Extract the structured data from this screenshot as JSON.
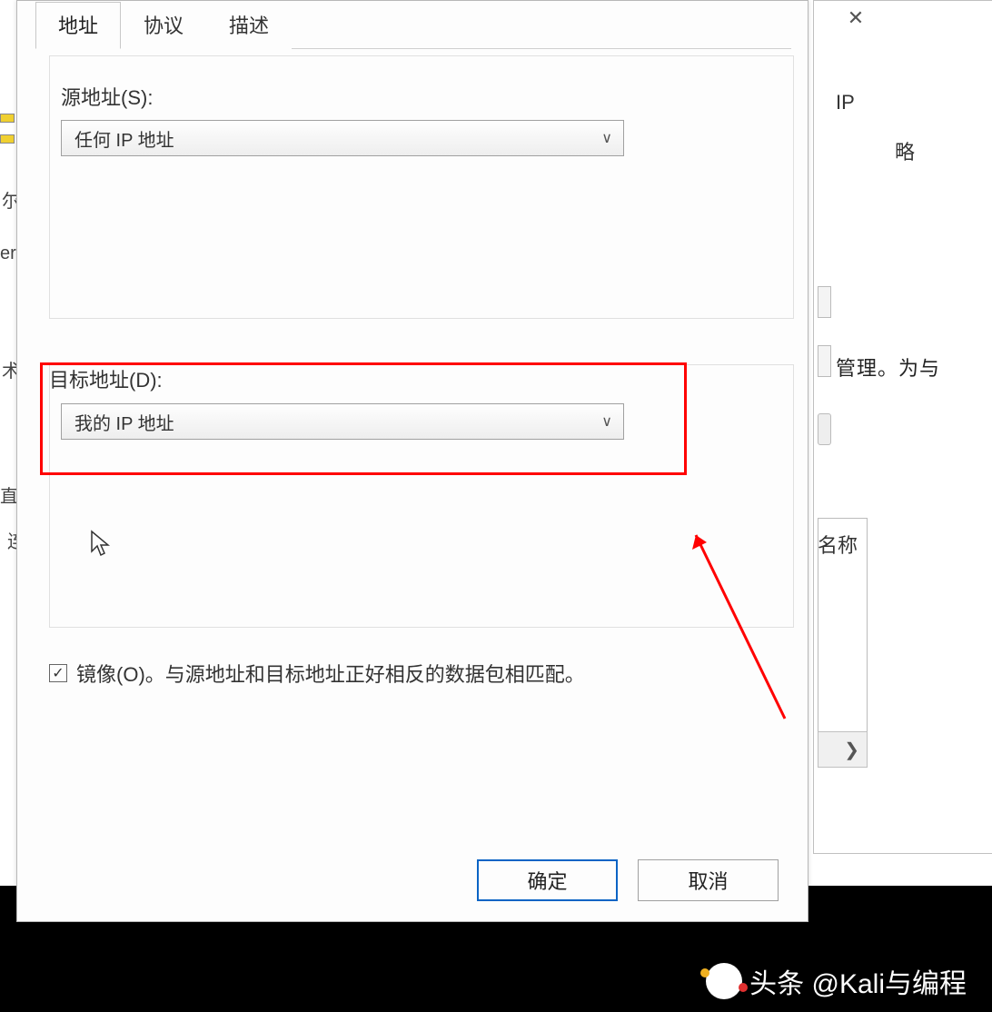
{
  "tabs": {
    "address": "地址",
    "protocol": "协议",
    "description": "描述"
  },
  "source": {
    "label": "源地址(S):",
    "value": "任何 IP 地址"
  },
  "destination": {
    "label": "目标地址(D):",
    "value": "我的 IP 地址"
  },
  "mirror": {
    "label": "镜像(O)。与源地址和目标地址正好相反的数据包相匹配。"
  },
  "buttons": {
    "ok": "确定",
    "cancel": "取消"
  },
  "background": {
    "close": "✕",
    "ip_label": "IP",
    "text2": "略",
    "text3": "管理。为与",
    "text4": "名称",
    "scroll": "❯",
    "left1": "尔",
    "left2": "er",
    "left3": "术",
    "left4": "直",
    "left5": "连"
  },
  "watermark": {
    "text": "头条 @Kali与编程"
  }
}
